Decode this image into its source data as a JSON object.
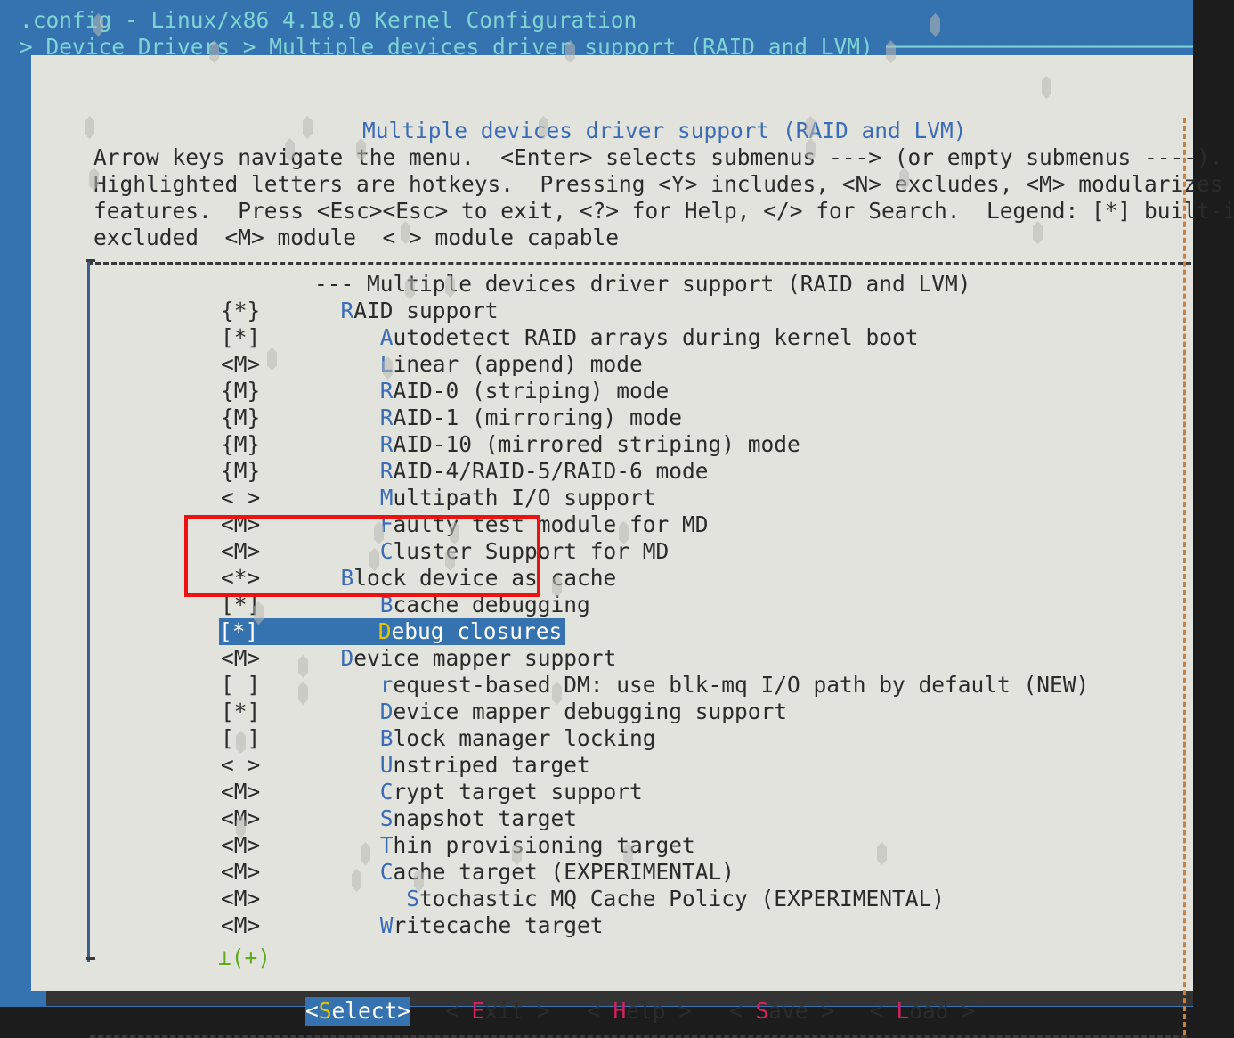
{
  "terminal": {
    "title_line": ".config - Linux/x86 4.18.0 Kernel Configuration",
    "breadcrumb_line": "> Device Drivers > Multiple devices driver support (RAID and LVM) ────────────────────────────────────"
  },
  "dialog": {
    "title": "Multiple devices driver support (RAID and LVM)",
    "help": [
      "Arrow keys navigate the menu.  <Enter> selects submenus ---> (or empty submenus ----).",
      "Highlighted letters are hotkeys.  Pressing <Y> includes, <N> excludes, <M> modularizes",
      "features.  Press <Esc><Esc> to exit, <?> for Help, </> for Search.  Legend: [*] built-in  [ ]",
      "excluded  <M> module  < > module capable"
    ],
    "scroll_indicator": "⊥(+)"
  },
  "menu": {
    "items": [
      {
        "mark": "",
        "indent": 0,
        "hot": "",
        "label": "--- Multiple devices driver support (RAID and LVM)",
        "selected": false
      },
      {
        "mark": "{*}",
        "indent": 1,
        "hot": "R",
        "label": "AID support",
        "selected": false
      },
      {
        "mark": "[*]",
        "indent": 2,
        "hot": "A",
        "label": "utodetect RAID arrays during kernel boot",
        "selected": false
      },
      {
        "mark": "<M>",
        "indent": 2,
        "hot": "L",
        "label": "inear (append) mode",
        "selected": false
      },
      {
        "mark": "{M}",
        "indent": 2,
        "hot": "R",
        "label": "AID-0 (striping) mode",
        "selected": false
      },
      {
        "mark": "{M}",
        "indent": 2,
        "hot": "R",
        "label": "AID-1 (mirroring) mode",
        "selected": false
      },
      {
        "mark": "{M}",
        "indent": 2,
        "hot": "R",
        "label": "AID-10 (mirrored striping) mode",
        "selected": false
      },
      {
        "mark": "{M}",
        "indent": 2,
        "hot": "R",
        "label": "AID-4/RAID-5/RAID-6 mode",
        "selected": false
      },
      {
        "mark": "< >",
        "indent": 2,
        "hot": "M",
        "label": "ultipath I/O support",
        "selected": false
      },
      {
        "mark": "<M>",
        "indent": 2,
        "hot": "F",
        "label": "aulty test module for MD",
        "selected": false
      },
      {
        "mark": "<M>",
        "indent": 2,
        "hot": "C",
        "label": "luster Support for MD",
        "selected": false
      },
      {
        "mark": "<*>",
        "indent": 1,
        "hot": "B",
        "label": "lock device as cache",
        "selected": false
      },
      {
        "mark": "[*]",
        "indent": 2,
        "hot": "B",
        "label": "cache debugging",
        "selected": false
      },
      {
        "mark": "[*]",
        "indent": 2,
        "hot": "D",
        "label": "ebug closures",
        "selected": true
      },
      {
        "mark": "<M>",
        "indent": 1,
        "hot": "D",
        "label": "evice mapper support",
        "selected": false
      },
      {
        "mark": "[ ]",
        "indent": 2,
        "hot": "r",
        "label": "equest-based DM: use blk-mq I/O path by default (NEW)",
        "selected": false
      },
      {
        "mark": "[*]",
        "indent": 2,
        "hot": "D",
        "label": "evice mapper debugging support",
        "selected": false
      },
      {
        "mark": "[ ]",
        "indent": 2,
        "hot": "B",
        "label": "lock manager locking",
        "selected": false
      },
      {
        "mark": "< >",
        "indent": 2,
        "hot": "U",
        "label": "nstriped target",
        "selected": false
      },
      {
        "mark": "<M>",
        "indent": 2,
        "hot": "C",
        "label": "rypt target support",
        "selected": false
      },
      {
        "mark": "<M>",
        "indent": 2,
        "hot": "S",
        "label": "napshot target",
        "selected": false
      },
      {
        "mark": "<M>",
        "indent": 2,
        "hot": "T",
        "label": "hin provisioning target",
        "selected": false
      },
      {
        "mark": "<M>",
        "indent": 2,
        "hot": "C",
        "label": "ache target (EXPERIMENTAL)",
        "selected": false
      },
      {
        "mark": "<M>",
        "indent": 3,
        "hot": "S",
        "label": "tochastic MQ Cache Policy (EXPERIMENTAL)",
        "selected": false
      },
      {
        "mark": "<M>",
        "indent": 2,
        "hot": "W",
        "label": "ritecache target",
        "selected": false
      }
    ]
  },
  "buttons": [
    {
      "pre": "<",
      "hot": "S",
      "post": "elect>",
      "active": true
    },
    {
      "pre": "< ",
      "hot": "E",
      "post": "xit >",
      "active": false
    },
    {
      "pre": "< ",
      "hot": "H",
      "post": "elp >",
      "active": false
    },
    {
      "pre": "< ",
      "hot": "S",
      "post": "ave >",
      "active": false
    },
    {
      "pre": "< ",
      "hot": "L",
      "post": "oad >",
      "active": false
    }
  ],
  "colors": {
    "terminal_bg": "#1c1c1c",
    "screen_blue": "#3572b0",
    "dialog_bg": "#e2e3dd",
    "header_cyan": "#7fd4d4",
    "menu_blue": "#3b6cb5",
    "selected_bg": "#3572b0",
    "hotkey_yellow": "#e8c300",
    "button_hotkey": "#d6205f",
    "annotation_red": "#ee1111",
    "scroll_green": "#5faa1e"
  }
}
